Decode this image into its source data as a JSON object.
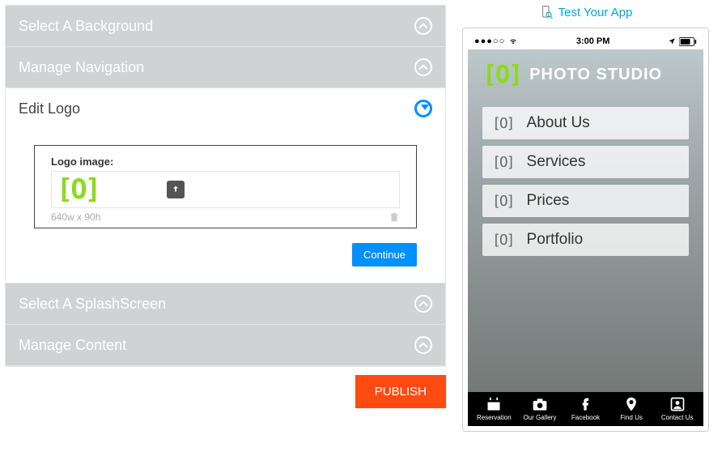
{
  "accordion": {
    "background": {
      "title": "Select A Background"
    },
    "navigation": {
      "title": "Manage Navigation"
    },
    "logo": {
      "title": "Edit Logo",
      "image_label": "Logo image:",
      "dimensions": "640w x 90h",
      "continue": "Continue"
    },
    "splash": {
      "title": "Select A SplashScreen"
    },
    "content": {
      "title": "Manage Content"
    }
  },
  "publish_label": "PUBLISH",
  "test_app_label": "Test Your App",
  "phone": {
    "time": "3:00 PM",
    "app_title": "PHOTO STUDIO",
    "menu": [
      {
        "label": "About Us"
      },
      {
        "label": "Services"
      },
      {
        "label": "Prices"
      },
      {
        "label": "Portfolio"
      }
    ],
    "nav": [
      {
        "label": "Reservation"
      },
      {
        "label": "Our Gallery"
      },
      {
        "label": "Facebook"
      },
      {
        "label": "Find Us"
      },
      {
        "label": "Contact Us"
      }
    ]
  }
}
